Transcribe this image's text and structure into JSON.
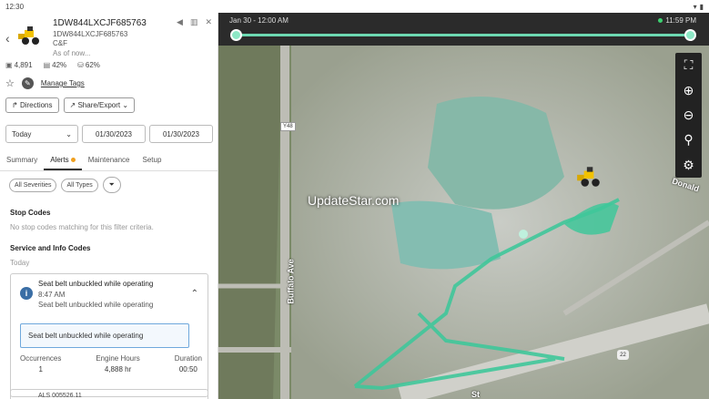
{
  "status": {
    "time": "12:30"
  },
  "header": {
    "title": "1DW844LXCJF685763",
    "subtitle": "1DW844LXCJF685763",
    "org": "C&F",
    "as_of": "As of now...",
    "back_icon": "chevron-left-icon"
  },
  "stats": {
    "hours": "4,891",
    "fuel": "42%",
    "def": "62%"
  },
  "tags": {
    "manage_label": "Manage Tags"
  },
  "actions": {
    "directions": "Directions",
    "share_export": "Share/Export"
  },
  "dates": {
    "range": "Today",
    "from": "01/30/2023",
    "to": "01/30/2023"
  },
  "tabs": {
    "summary": "Summary",
    "alerts": "Alerts",
    "maintenance": "Maintenance",
    "setup": "Setup"
  },
  "filters": {
    "severities": "All Severities",
    "types": "All Types"
  },
  "stop_codes": {
    "heading": "Stop Codes",
    "empty": "No stop codes matching for this filter criteria."
  },
  "service_codes": {
    "heading": "Service and Info Codes",
    "day": "Today"
  },
  "alert": {
    "title": "Seat belt unbuckled while operating",
    "time": "8:47 AM",
    "desc": "Seat belt unbuckled while operating",
    "highlight": "Seat belt unbuckled while operating",
    "occ_label": "Occurrences",
    "occ_value": "1",
    "hours_label": "Engine Hours",
    "hours_value": "4,888 hr",
    "dur_label": "Duration",
    "dur_value": "00:50"
  },
  "alert2": {
    "title": "ALS 005526.11"
  },
  "timeline": {
    "start": "Jan 30 - 12:00 AM",
    "end": "11:59 PM"
  },
  "map": {
    "watermark": "UpdateStar.com",
    "road_buffalo": "Buffalo Ave",
    "road_donald": "Donald",
    "route_y48": "Y48",
    "route_22": "22",
    "street_bottom": "St"
  }
}
